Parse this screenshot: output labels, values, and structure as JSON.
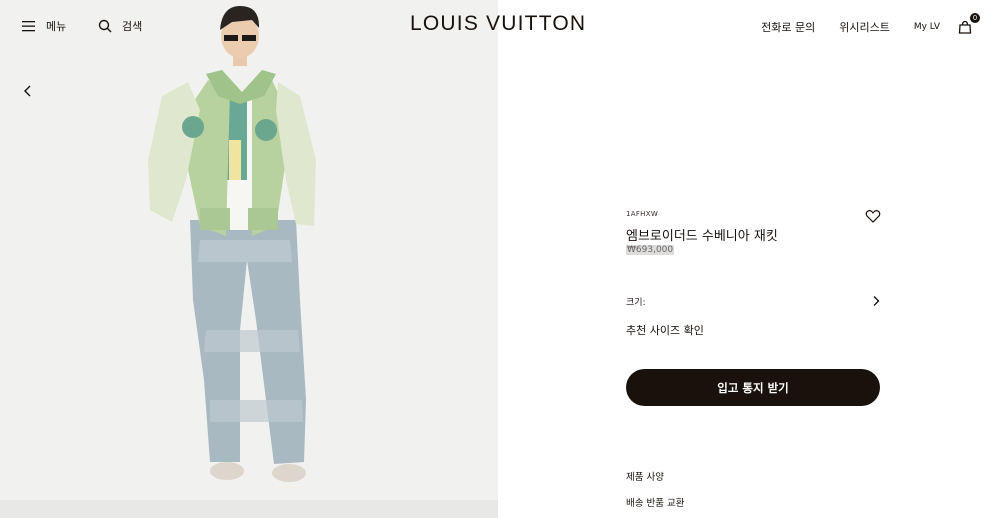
{
  "header": {
    "menu_label": "메뉴",
    "search_label": "검색",
    "logo": "LOUIS VUITTON",
    "contact_label": "전화로 문의",
    "wishlist_label": "위시리스트",
    "mylv_label": "My LV",
    "bag_count": "0",
    "icons": [
      "hamburger-menu-icon",
      "search-icon",
      "shopping-bag-icon",
      "chevron-left-icon"
    ]
  },
  "product": {
    "sku": "1AFHXW",
    "name": "엠브로이더드 수베니아 재킷",
    "price": "₩693,000",
    "size_label": "크기:",
    "fit_link": "추천 사이즈 확인",
    "notify_button": "입고 통지 받기",
    "specs_link": "제품 사양",
    "shipping_link": "배송 반품 교환",
    "icons": [
      "heart-icon",
      "chevron-right-icon"
    ]
  },
  "colors": {
    "brand_dark": "#19110b",
    "background": "#ffffff",
    "media_background": "#f1f1ef"
  }
}
